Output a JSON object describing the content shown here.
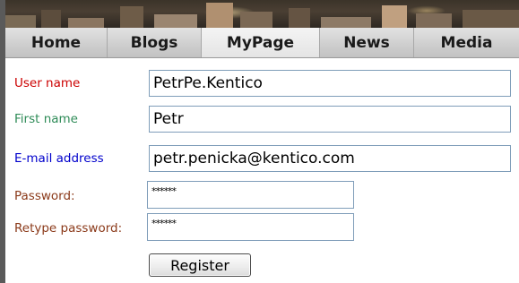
{
  "nav": {
    "items": [
      {
        "label": "Home",
        "active": false
      },
      {
        "label": "Blogs",
        "active": false
      },
      {
        "label": "MyPage",
        "active": true
      },
      {
        "label": "News",
        "active": false
      },
      {
        "label": "Media",
        "active": false
      }
    ]
  },
  "form": {
    "username": {
      "label": "User name",
      "value": "PetrPe.Kentico",
      "label_color": "#cc0000"
    },
    "firstname": {
      "label": "First name",
      "value": "Petr",
      "label_color": "#2e8b57"
    },
    "email": {
      "label": "E-mail address",
      "value": "petr.penicka@kentico.com",
      "label_color": "#0000cc"
    },
    "password": {
      "label": "Password:",
      "value": "******",
      "label_color": "#8b3a1a"
    },
    "retype": {
      "label": "Retype password:",
      "value": "******",
      "label_color": "#8b3a1a"
    },
    "register_label": "Register"
  },
  "colors": {
    "input_border": "#7f9db9",
    "nav_bg": "#cfcfcf"
  }
}
